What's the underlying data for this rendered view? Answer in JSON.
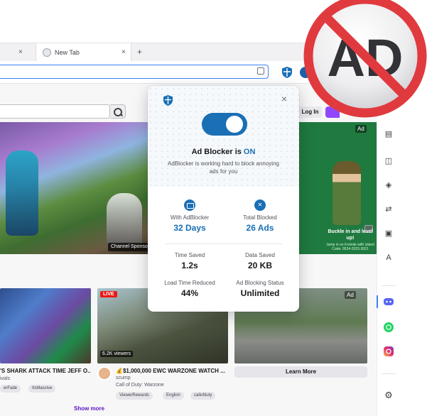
{
  "browser": {
    "tab_close": "×",
    "new_tab_label": "New Tab",
    "new_tab_plus": "+"
  },
  "page": {
    "login_label": "Log In",
    "channel_sponsor": "Channel Sponsors",
    "carousel_next": "›",
    "ad_badge": "Ad",
    "hero_ad_slogan": "Buckle in and level up!",
    "hero_ad_sub": "Jump in on Fortnite with Island Code: 9524-2023-3021",
    "live_badge": "LIVE",
    "viewers": "6.2K viewers",
    "learn_more": "Learn More",
    "stream1_title": "'S SHARK ATTACK TIME JEFF O...",
    "stream1_channel": "ivals",
    "stream1_tags": [
      "erFade",
      "ItsMassive"
    ],
    "stream2_title": "💰$1,000,000 EWC WARZONE WATCH ...",
    "stream2_channel": "scump",
    "stream2_game": "Call of Duty: Warzone",
    "stream2_tags": [
      "ViewerRewards",
      "English",
      "callofduty"
    ],
    "show_more": "Show more"
  },
  "popup": {
    "status_prefix": "Ad Blocker is ",
    "status_value": "ON",
    "status_description": "AdBlocker is working hard to block annoying ads for you",
    "close": "×",
    "stats": {
      "with_adblocker": {
        "label": "With AdBlocker",
        "value": "32 Days"
      },
      "total_blocked": {
        "label": "Total Blocked",
        "value": "26 Ads"
      },
      "time_saved": {
        "label": "Time Saved",
        "value": "1.2s"
      },
      "data_saved": {
        "label": "Data Saved",
        "value": "20 KB"
      },
      "load_time_reduced": {
        "label": "Load Time Reduced",
        "value": "44%"
      },
      "blocking_status": {
        "label": "Ad Blocking Status",
        "value": "Unlimited"
      }
    }
  },
  "badge": {
    "text": "AD"
  },
  "colors": {
    "accent": "#1a6fb5",
    "badge_red": "#e03a3e",
    "twitch_purple": "#9147ff"
  }
}
